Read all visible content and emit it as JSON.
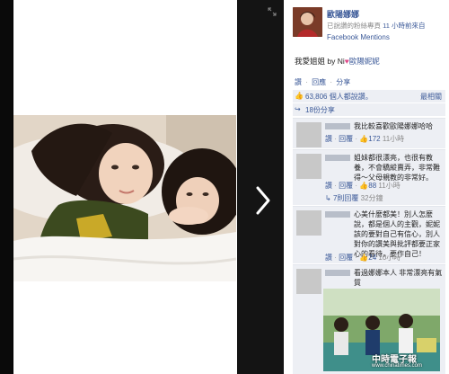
{
  "post": {
    "poster_name": "歐陽娜娜",
    "meta_prefix": "已說讚的粉絲專頁",
    "meta_time": "11 小時前來自",
    "source": "Facebook Mentions",
    "caption_text": "我愛姐姐 by Ni",
    "caption_mention": "歐陽妮妮"
  },
  "actions": {
    "like": "讚",
    "comment": "回應",
    "share": "分享",
    "separator": "·"
  },
  "likes": {
    "count": "63,806 個人都說讚。",
    "top_label": "最相關"
  },
  "shares": {
    "count": "18份分享"
  },
  "comments": [
    {
      "text": "我比較喜歡歐陽娜娜哈哈",
      "like": "讚",
      "reply": "回覆",
      "count": "172",
      "time": "11小時"
    },
    {
      "text": "姐妹都很漂亮，也很有教養，不會驕縱賣弄，非常難得～父母親教的非常好。",
      "like": "讚",
      "reply": "回覆",
      "count": "88",
      "time": "11小時",
      "replies": "7則回覆",
      "replies_time": "32分鐘"
    },
    {
      "text": "心美什麼都美！別人怎麼說，都是個人的主觀，妮妮該的要對自己有信心，別人對你的讚美與批評都要正家心的看待，要作自己！",
      "like": "讚",
      "reply": "回覆",
      "count": "24",
      "time": "10小時"
    },
    {
      "text": "看過娜娜本人 非常漂亮有氣質"
    }
  ],
  "watermark": "中時電子報",
  "watermark_url": "www.chinatimes.com",
  "colors": {
    "fb_blue": "#3b5998",
    "comment_bg": "#edeff4",
    "heart": "#e04a8a"
  }
}
